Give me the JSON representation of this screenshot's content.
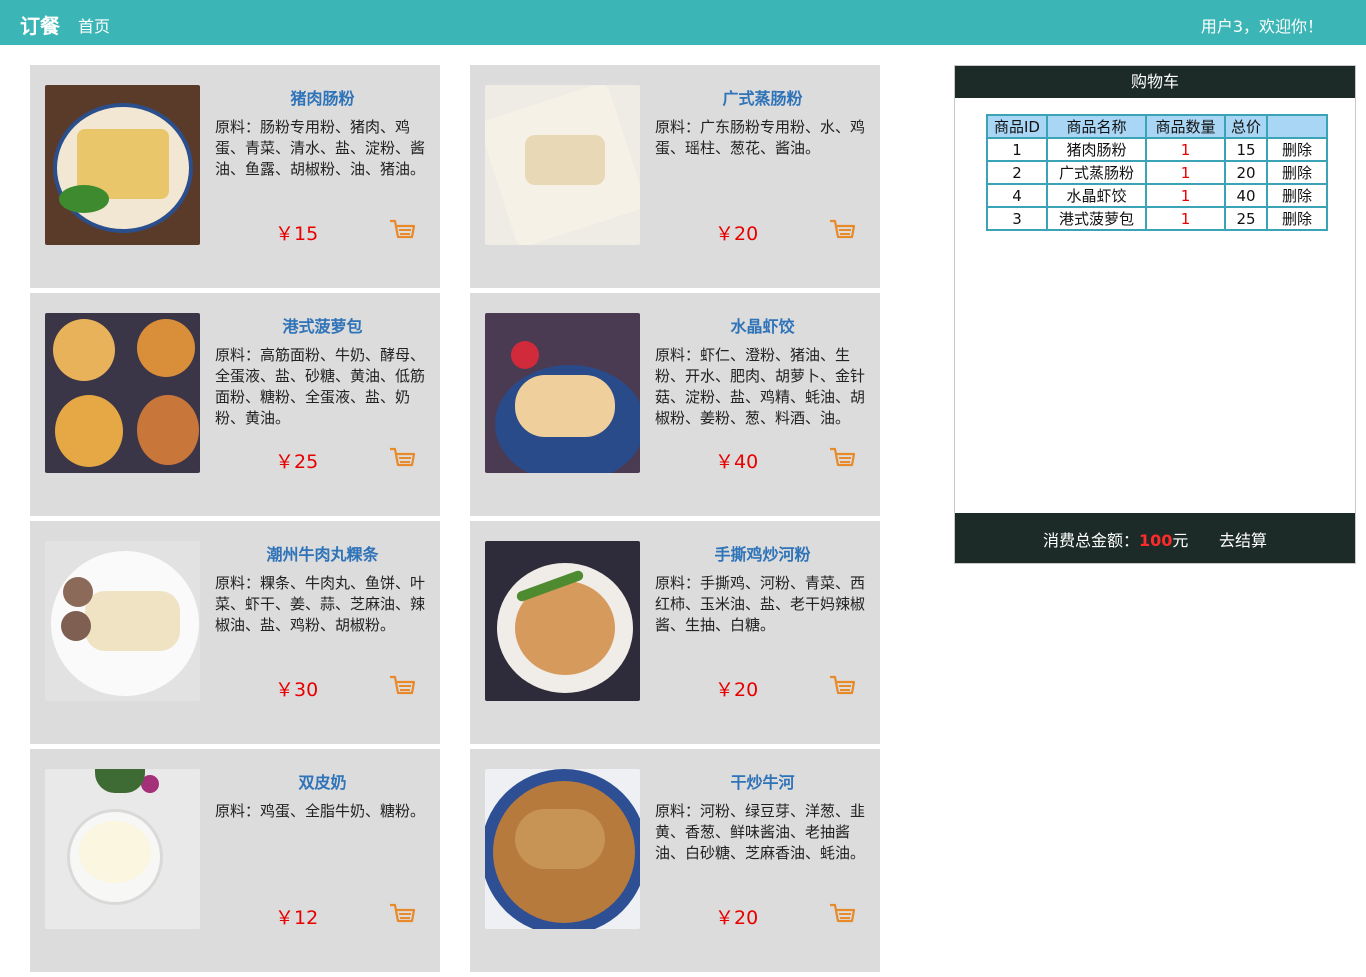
{
  "header": {
    "brand": "订餐",
    "home": "首页",
    "welcome": "用户3，欢迎你！"
  },
  "currency": "￥",
  "products": [
    {
      "name": "猪肉肠粉",
      "ingredients": "原料：肠粉专用粉、猪肉、鸡蛋、青菜、清水、盐、淀粉、酱油、鱼露、胡椒粉、油、猪油。",
      "price": "￥15"
    },
    {
      "name": "广式蒸肠粉",
      "ingredients": "原料：广东肠粉专用粉、水、鸡蛋、瑶柱、葱花、酱油。",
      "price": "￥20"
    },
    {
      "name": "港式菠萝包",
      "ingredients": "原料：高筋面粉、牛奶、酵母、全蛋液、盐、砂糖、黄油、低筋面粉、糖粉、全蛋液、盐、奶粉、黄油。",
      "price": "￥25"
    },
    {
      "name": "水晶虾饺",
      "ingredients": "原料：虾仁、澄粉、猪油、生粉、开水、肥肉、胡萝卜、金针菇、淀粉、盐、鸡精、蚝油、胡椒粉、姜粉、葱、料酒、油。",
      "price": "￥40"
    },
    {
      "name": "潮州牛肉丸粿条",
      "ingredients": "原料：粿条、牛肉丸、鱼饼、叶菜、虾干、姜、蒜、芝麻油、辣椒油、盐、鸡粉、胡椒粉。",
      "price": "￥30"
    },
    {
      "name": "手撕鸡炒河粉",
      "ingredients": "原料：手撕鸡、河粉、青菜、西红柿、玉米油、盐、老干妈辣椒酱、生抽、白糖。",
      "price": "￥20"
    },
    {
      "name": "双皮奶",
      "ingredients": "原料：鸡蛋、全脂牛奶、糖粉。",
      "price": "￥12"
    },
    {
      "name": "干炒牛河",
      "ingredients": "原料：河粉、绿豆芽、洋葱、韭黄、香葱、鲜味酱油、老抽酱油、白砂糖、芝麻香油、蚝油。",
      "price": "￥20"
    }
  ],
  "cart": {
    "title": "购物车",
    "columns": [
      "商品ID",
      "商品名称",
      "商品数量",
      "总价",
      ""
    ],
    "rows": [
      {
        "id": "1",
        "name": "猪肉肠粉",
        "qty": "1",
        "total": "15",
        "action": "删除"
      },
      {
        "id": "2",
        "name": "广式蒸肠粉",
        "qty": "1",
        "total": "20",
        "action": "删除"
      },
      {
        "id": "4",
        "name": "水晶虾饺",
        "qty": "1",
        "total": "40",
        "action": "删除"
      },
      {
        "id": "3",
        "name": "港式菠萝包",
        "qty": "1",
        "total": "25",
        "action": "删除"
      }
    ],
    "total_label": "消费总金额：",
    "total_value": "100",
    "total_unit": "元",
    "checkout": "去结算"
  },
  "icons": {
    "cart_add": "shopping-cart-icon"
  },
  "colors": {
    "header": "#3bb5b5",
    "card": "#dcdcdc",
    "name": "#2f73b8",
    "price": "#e80000",
    "cart_icon": "#e8892a",
    "cart_dark": "#1c2b27"
  }
}
